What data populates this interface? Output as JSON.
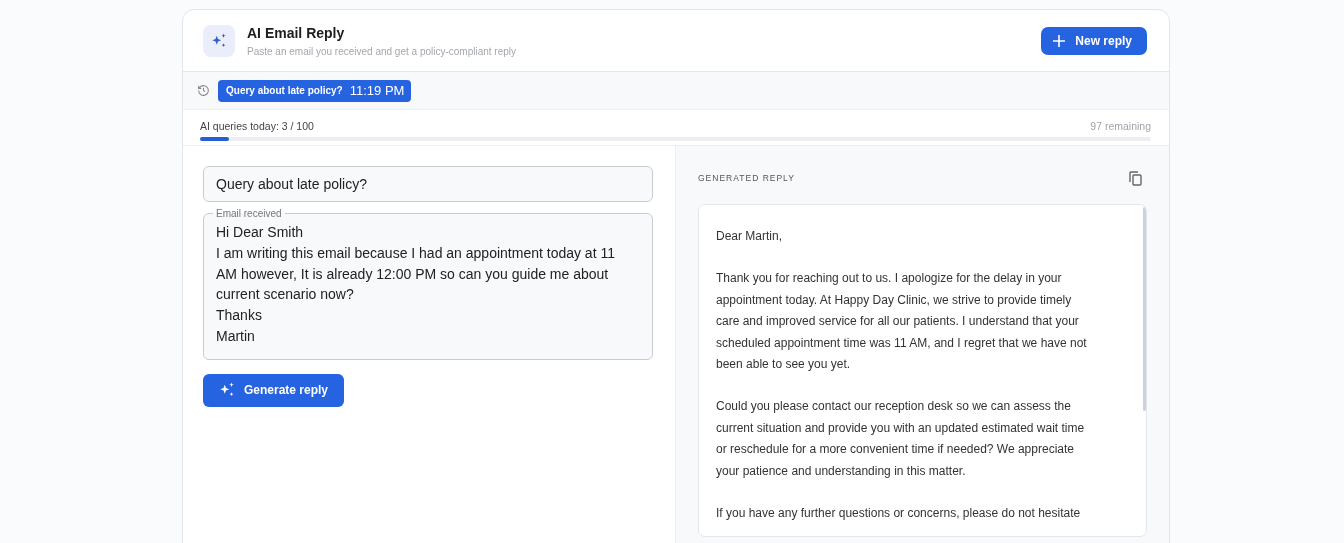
{
  "header": {
    "title": "AI Email Reply",
    "subtitle": "Paste an email you received and get a policy-compliant reply",
    "new_button": "New reply"
  },
  "history": [
    {
      "label": "Query about late policy?",
      "time": "11:19 PM",
      "selected": true
    }
  ],
  "usage": {
    "label": "AI queries today: 3 / 100",
    "remaining": "97 remaining",
    "level": 0.03
  },
  "compose": {
    "subject": "Query about late policy?",
    "email_label": "Email received",
    "email_lines": [
      "Hi Dear Smith",
      "I am writing this email because I had an appointment today at 11",
      "AM however, It is already 12:00 PM so can you guide me about",
      "current scenario now?",
      "Thanks",
      "Martin"
    ],
    "generate_button": "Generate reply"
  },
  "reply": {
    "heading": "GENERATED REPLY",
    "paragraphs": [
      [
        "Dear Martin,"
      ],
      [
        "Thank you for reaching out to us. I apologize for the delay in your",
        "appointment today. At Happy Day Clinic, we strive to provide timely",
        "care and improved service for all our patients. I understand that your",
        "scheduled appointment time was 11 AM, and I regret that we have not",
        "been able to see you yet."
      ],
      [
        "Could you please contact our reception desk so we can assess the",
        "current situation and provide you with an updated estimated wait time",
        "or reschedule for a more convenient time if needed? We appreciate",
        "your patience and understanding in this matter."
      ],
      [
        "If you have any further questions or concerns, please do not hesitate"
      ]
    ]
  }
}
